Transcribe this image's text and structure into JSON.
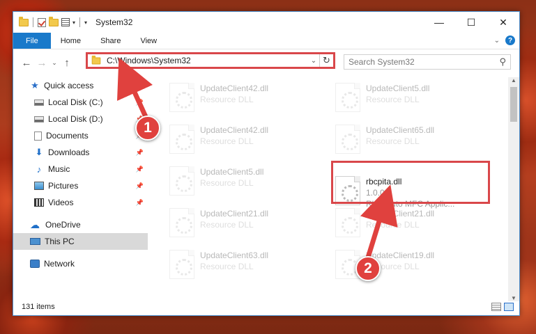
{
  "window": {
    "title": "System32"
  },
  "ribbon": {
    "tabs": [
      "File",
      "Home",
      "Share",
      "View"
    ]
  },
  "address": {
    "path": "C:\\Windows\\System32"
  },
  "search": {
    "placeholder": "Search System32"
  },
  "sidebar": {
    "items": [
      {
        "label": "Quick access",
        "icon": "star-icon"
      },
      {
        "label": "Local Disk (C:)",
        "icon": "disk-icon",
        "pinned": true
      },
      {
        "label": "Local Disk (D:)",
        "icon": "disk-icon",
        "pinned": true
      },
      {
        "label": "Documents",
        "icon": "documents-icon",
        "pinned": true
      },
      {
        "label": "Downloads",
        "icon": "download-icon",
        "pinned": true
      },
      {
        "label": "Music",
        "icon": "music-icon",
        "pinned": true
      },
      {
        "label": "Pictures",
        "icon": "pictures-icon",
        "pinned": true
      },
      {
        "label": "Videos",
        "icon": "videos-icon",
        "pinned": true
      },
      {
        "label": "OneDrive",
        "icon": "cloud-icon"
      },
      {
        "label": "This PC",
        "icon": "pc-icon",
        "selected": true
      },
      {
        "label": "Network",
        "icon": "network-icon"
      }
    ]
  },
  "files": [
    {
      "name": "UpdateClient42.dll",
      "desc": "Resource DLL"
    },
    {
      "name": "UpdateClient5.dll",
      "desc": "Resource DLL"
    },
    {
      "name": "UpdateClient42.dll",
      "desc": "Resource DLL"
    },
    {
      "name": "UpdateClient65.dll",
      "desc": "Resource DLL"
    },
    {
      "name": "UpdateClient5.dll",
      "desc": "Resource DLL"
    },
    {
      "name": "rbcpita.dll",
      "desc": "1.0.0.1",
      "desc2": "RbcpAuto MFC Applic..."
    },
    {
      "name": "UpdateClient21.dll",
      "desc": "Resource DLL"
    },
    {
      "name": "UpdateClient21.dll",
      "desc": "Resource DLL"
    },
    {
      "name": "UpdateClient63.dll",
      "desc": "Resource DLL"
    },
    {
      "name": "UpdateClient19.dll",
      "desc": "Resource DLL"
    }
  ],
  "status": {
    "count": "131 items"
  },
  "annotations": {
    "step1": "1",
    "step2": "2",
    "color": "#e0413e"
  }
}
